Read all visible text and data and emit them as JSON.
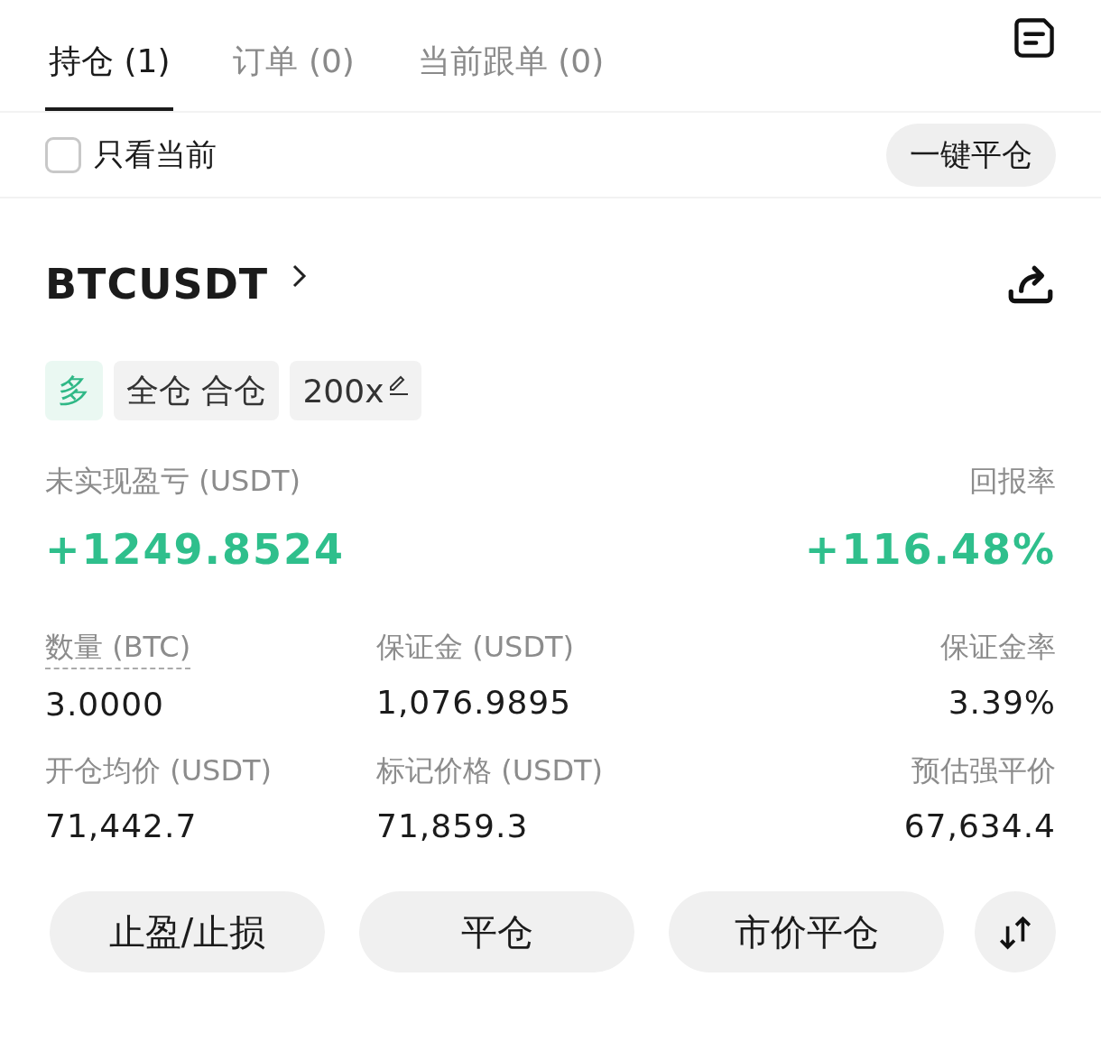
{
  "tabs": [
    {
      "label": "持仓 (1)",
      "selected": true
    },
    {
      "label": "订单 (0)",
      "selected": false
    },
    {
      "label": "当前跟单 (0)",
      "selected": false
    }
  ],
  "filter": {
    "label": "只看当前",
    "checked": false
  },
  "close_all_button": "一键平仓",
  "position": {
    "symbol": "BTCUSDT",
    "tags": [
      {
        "kind": "side",
        "label": "多"
      },
      {
        "kind": "mode",
        "label": "全仓 合仓"
      },
      {
        "kind": "leverage",
        "label": "200x"
      }
    ],
    "pnl": {
      "label": "未实现盈亏 (USDT)",
      "value": "+1249.8524"
    },
    "roe": {
      "label": "回报率",
      "value": "+116.48%"
    },
    "stats": [
      {
        "label": "数量 (BTC)",
        "value": "3.0000",
        "underlined": true
      },
      {
        "label": "保证金 (USDT)",
        "value": "1,076.9895",
        "underlined": false
      },
      {
        "label": "保证金率",
        "value": "3.39%",
        "underlined": false
      },
      {
        "label": "开仓均价 (USDT)",
        "value": "71,442.7",
        "underlined": false
      },
      {
        "label": "标记价格 (USDT)",
        "value": "71,859.3",
        "underlined": false
      },
      {
        "label": "预估强平价",
        "value": "67,634.4",
        "underlined": false
      }
    ]
  },
  "actions": [
    "止盈/止损",
    "平仓",
    "市价平仓"
  ]
}
